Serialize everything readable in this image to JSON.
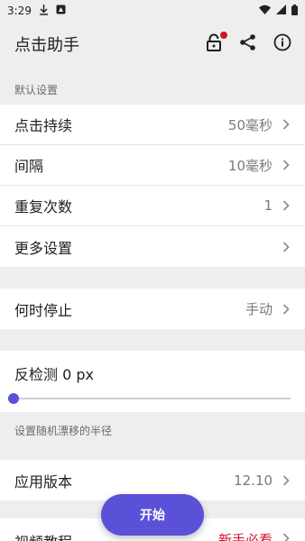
{
  "status_bar": {
    "time": "3:29",
    "icons": [
      "download-icon",
      "notification-icon",
      "wifi-icon",
      "signal-icon",
      "battery-icon"
    ]
  },
  "app_bar": {
    "title": "点击助手",
    "actions": [
      "lock-icon",
      "share-icon",
      "info-icon"
    ]
  },
  "default_settings": {
    "header": "默认设置",
    "rows": [
      {
        "label": "点击持续",
        "value": "50毫秒"
      },
      {
        "label": "间隔",
        "value": "10毫秒"
      },
      {
        "label": "重复次数",
        "value": "1"
      },
      {
        "label": "更多设置",
        "value": ""
      }
    ]
  },
  "stop": {
    "label": "何时停止",
    "value": "手动"
  },
  "anti_detect": {
    "label": "反检测 0 px",
    "slider_fraction": 0,
    "help": "设置随机漂移的半径"
  },
  "app_version": {
    "label": "应用版本",
    "value": "12.10"
  },
  "tutorial": {
    "label": "视频教程",
    "value": "新手必看"
  },
  "fab": {
    "label": "开始"
  },
  "colors": {
    "accent": "#5b51d8",
    "badge": "#d1122a",
    "background": "#eeeeee"
  }
}
